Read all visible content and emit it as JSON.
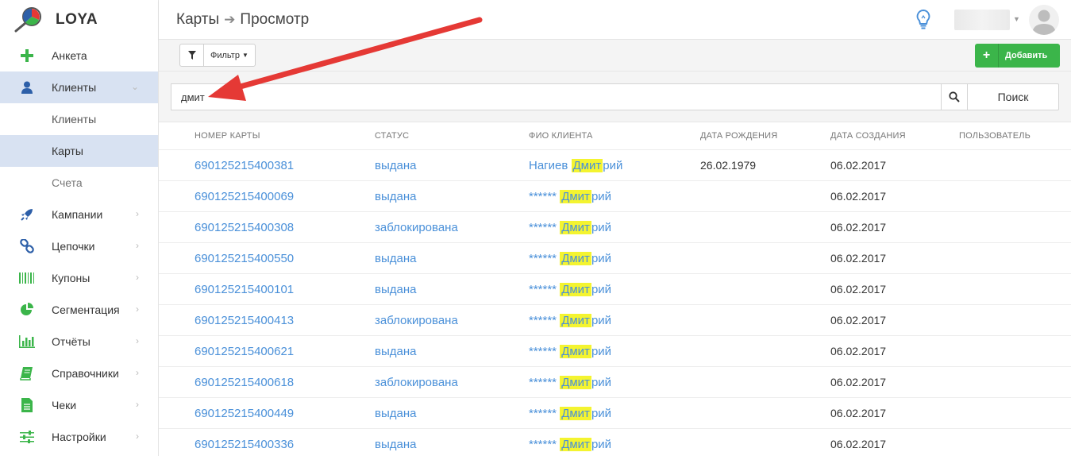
{
  "brand": {
    "name": "LOYA"
  },
  "sidebar": {
    "items": [
      {
        "label": "Анкета",
        "icon": "plus-icon",
        "color": "#3bb54a"
      },
      {
        "label": "Клиенты",
        "icon": "user-icon",
        "color": "#2d5fa8"
      },
      {
        "label": "Клиенты",
        "sub": true
      },
      {
        "label": "Карты",
        "sub": true
      },
      {
        "label": "Счета",
        "sub": true
      },
      {
        "label": "Кампании",
        "icon": "rocket-icon",
        "color": "#2d5fa8"
      },
      {
        "label": "Цепочки",
        "icon": "chain-icon",
        "color": "#2d5fa8"
      },
      {
        "label": "Купоны",
        "icon": "barcode-icon",
        "color": "#3bb54a"
      },
      {
        "label": "Сегментация",
        "icon": "pie-chart-icon",
        "color": "#3bb54a"
      },
      {
        "label": "Отчёты",
        "icon": "bar-chart-icon",
        "color": "#3bb54a"
      },
      {
        "label": "Справочники",
        "icon": "book-icon",
        "color": "#3bb54a"
      },
      {
        "label": "Чеки",
        "icon": "receipt-icon",
        "color": "#3bb54a"
      },
      {
        "label": "Настройки",
        "icon": "sliders-icon",
        "color": "#3bb54a"
      }
    ]
  },
  "header": {
    "crumb1": "Карты",
    "crumb2": "Просмотр"
  },
  "toolbar": {
    "filter_label": "Фильтр",
    "add_label": "Добавить"
  },
  "search": {
    "value": "дмит",
    "button_label": "Поиск"
  },
  "table": {
    "headers": [
      "НОМЕР КАРТЫ",
      "СТАТУС",
      "ФИО КЛИЕНТА",
      "ДАТА РОЖДЕНИЯ",
      "ДАТА СОЗДАНИЯ",
      "ПОЛЬЗОВАТЕЛЬ"
    ],
    "rows": [
      {
        "card": "690125215400381",
        "status": "выдана",
        "name_prefix": "Нагиев",
        "name_hl": "Дмит",
        "name_rest": "рий",
        "birth": "26.02.1979",
        "created": "06.02.2017"
      },
      {
        "card": "690125215400069",
        "status": "выдана",
        "name_prefix": "******",
        "name_hl": "Дмит",
        "name_rest": "рий",
        "birth": "",
        "created": "06.02.2017"
      },
      {
        "card": "690125215400308",
        "status": "заблокирована",
        "name_prefix": "******",
        "name_hl": "Дмит",
        "name_rest": "рий",
        "birth": "",
        "created": "06.02.2017"
      },
      {
        "card": "690125215400550",
        "status": "выдана",
        "name_prefix": "******",
        "name_hl": "Дмит",
        "name_rest": "рий",
        "birth": "",
        "created": "06.02.2017"
      },
      {
        "card": "690125215400101",
        "status": "выдана",
        "name_prefix": "******",
        "name_hl": "Дмит",
        "name_rest": "рий",
        "birth": "",
        "created": "06.02.2017"
      },
      {
        "card": "690125215400413",
        "status": "заблокирована",
        "name_prefix": "******",
        "name_hl": "Дмит",
        "name_rest": "рий",
        "birth": "",
        "created": "06.02.2017"
      },
      {
        "card": "690125215400621",
        "status": "выдана",
        "name_prefix": "******",
        "name_hl": "Дмит",
        "name_rest": "рий",
        "birth": "",
        "created": "06.02.2017"
      },
      {
        "card": "690125215400618",
        "status": "заблокирована",
        "name_prefix": "******",
        "name_hl": "Дмит",
        "name_rest": "рий",
        "birth": "",
        "created": "06.02.2017"
      },
      {
        "card": "690125215400449",
        "status": "выдана",
        "name_prefix": "******",
        "name_hl": "Дмит",
        "name_rest": "рий",
        "birth": "",
        "created": "06.02.2017"
      },
      {
        "card": "690125215400336",
        "status": "выдана",
        "name_prefix": "******",
        "name_hl": "Дмит",
        "name_rest": "рий",
        "birth": "",
        "created": "06.02.2017"
      }
    ]
  },
  "colors": {
    "accent": "#4a90d9",
    "add_button": "#3bb54a",
    "highlight": "#f4f430",
    "arrow": "#e53935"
  }
}
